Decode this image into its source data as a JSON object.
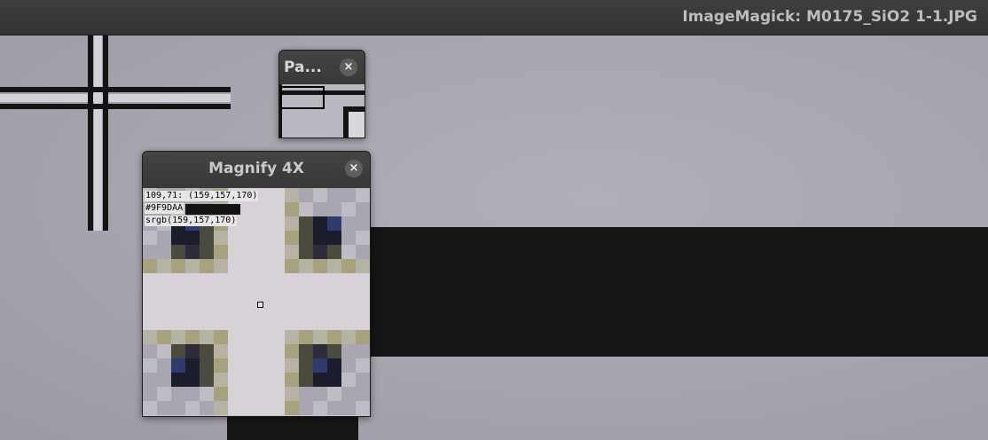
{
  "window": {
    "title": "ImageMagick: M0175_SiO2 1-1.JPG"
  },
  "pan_window": {
    "title": "Pa...",
    "close_icon": "×"
  },
  "magnify_window": {
    "title": "Magnify 4X",
    "close_icon": "×",
    "pixel_info": {
      "coords_line": "109,71: (159,157,170)",
      "hex_line": "#9F9DAA",
      "srgb_line": "srgb(159,157,170)"
    }
  },
  "colors": {
    "sampled_pixel": "#9F9DAA",
    "background": "#a5a2ac",
    "dark_features": "#141414"
  }
}
